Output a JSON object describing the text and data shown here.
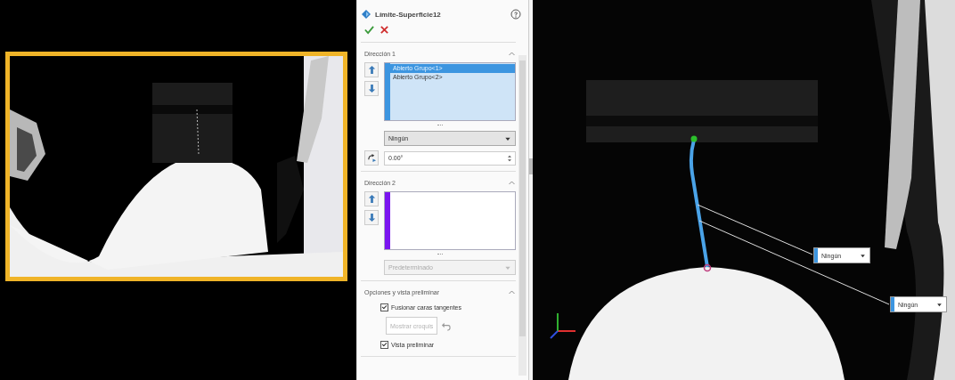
{
  "property_manager": {
    "title": "Límite-Superficie12",
    "direction_1": {
      "title": "Dirección 1",
      "expanded": true,
      "items": [
        {
          "label": "Abierto Grupo<1>",
          "selected": true
        },
        {
          "label": "Abierto Grupo<2>",
          "selected": false
        }
      ],
      "tangency": {
        "value": "Ningún",
        "disabled": false
      },
      "angle": {
        "value": "0.00°"
      }
    },
    "direction_2": {
      "title": "Dirección 2",
      "expanded": true,
      "tangency": {
        "value": "Predeterminado",
        "disabled": true
      }
    },
    "options": {
      "title": "Opciones y vista preliminar",
      "expanded": true,
      "merge_tangent": {
        "label": "Fusionar caras tangentes",
        "checked": true
      },
      "show_sketch": {
        "label": "Mostrar croquis",
        "disabled": true
      },
      "preview": {
        "label": "Vista preliminar",
        "checked": true
      }
    }
  },
  "viewport": {
    "callouts": [
      {
        "value": "Ningún"
      },
      {
        "value": "Ningún"
      }
    ]
  }
}
